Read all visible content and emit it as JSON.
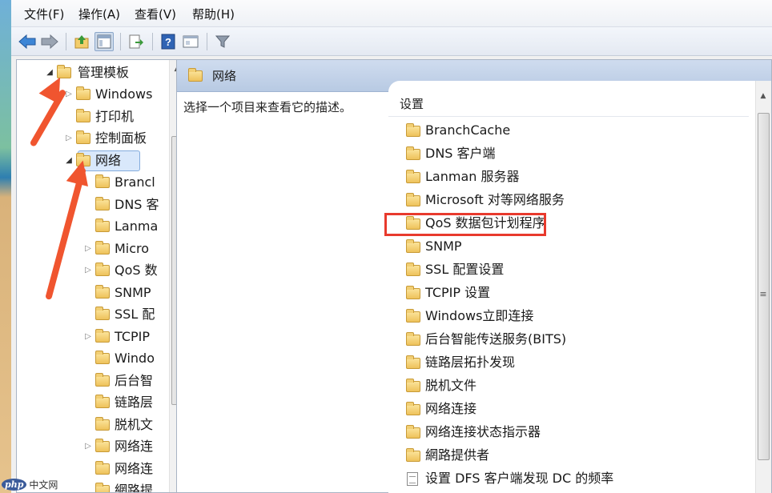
{
  "menu": {
    "file": "文件(F)",
    "action": "操作(A)",
    "view": "查看(V)",
    "help": "帮助(H)"
  },
  "toolbar_icons": [
    "back-icon",
    "forward-icon",
    "up-folder-icon",
    "show-hide-tree-icon",
    "export-list-icon",
    "help-icon",
    "properties-icon",
    "filter-icon"
  ],
  "tree": {
    "root": "管理模板",
    "items": [
      {
        "label": "Windows",
        "expander": "closed"
      },
      {
        "label": "打印机",
        "expander": "none"
      },
      {
        "label": "控制面板",
        "expander": "closed"
      },
      {
        "label": "网络",
        "expander": "open",
        "selected": true
      },
      {
        "label": "Brancl",
        "expander": "none"
      },
      {
        "label": "DNS 客",
        "expander": "none"
      },
      {
        "label": "Lanma",
        "expander": "none"
      },
      {
        "label": "Micro",
        "expander": "closed"
      },
      {
        "label": "QoS 数",
        "expander": "closed"
      },
      {
        "label": "SNMP",
        "expander": "none"
      },
      {
        "label": "SSL 配",
        "expander": "none"
      },
      {
        "label": "TCPIP",
        "expander": "closed"
      },
      {
        "label": "Windo",
        "expander": "none"
      },
      {
        "label": "后台智",
        "expander": "none"
      },
      {
        "label": "链路层",
        "expander": "none"
      },
      {
        "label": "脱机文",
        "expander": "none"
      },
      {
        "label": "网络连",
        "expander": "closed"
      },
      {
        "label": "网络连",
        "expander": "none"
      },
      {
        "label": "網路提",
        "expander": "none"
      }
    ]
  },
  "right_pane": {
    "title": "网络",
    "description": "选择一个项目来查看它的描述。",
    "column_header": "设置",
    "items": [
      {
        "label": "BranchCache",
        "icon": "folder-icon"
      },
      {
        "label": "DNS 客户端",
        "icon": "folder-icon"
      },
      {
        "label": "Lanman 服务器",
        "icon": "folder-icon"
      },
      {
        "label": "Microsoft 对等网络服务",
        "icon": "folder-icon"
      },
      {
        "label": "QoS 数据包计划程序",
        "icon": "folder-icon",
        "highlighted": true
      },
      {
        "label": "SNMP",
        "icon": "folder-icon"
      },
      {
        "label": "SSL 配置设置",
        "icon": "folder-icon"
      },
      {
        "label": "TCPIP 设置",
        "icon": "folder-icon"
      },
      {
        "label": "Windows立即连接",
        "icon": "folder-icon"
      },
      {
        "label": "后台智能传送服务(BITS)",
        "icon": "folder-icon"
      },
      {
        "label": "链路层拓扑发现",
        "icon": "folder-icon"
      },
      {
        "label": "脱机文件",
        "icon": "folder-icon"
      },
      {
        "label": "网络连接",
        "icon": "folder-icon"
      },
      {
        "label": "网络连接状态指示器",
        "icon": "folder-icon"
      },
      {
        "label": "網路提供者",
        "icon": "folder-icon"
      },
      {
        "label": "设置 DFS 客户端发现 DC 的频率",
        "icon": "setting-icon"
      }
    ]
  },
  "watermark": {
    "logo": "php",
    "text": "中文网"
  },
  "colors": {
    "annotation": "#f0552f",
    "highlight_border": "#e83a2d"
  }
}
